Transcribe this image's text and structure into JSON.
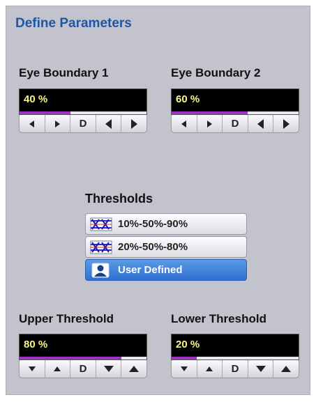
{
  "title": "Define Parameters",
  "eye_boundary_1": {
    "label": "Eye Boundary 1",
    "value": "40 %",
    "level_percent": 40
  },
  "eye_boundary_2": {
    "label": "Eye Boundary 2",
    "value": "60 %",
    "level_percent": 60
  },
  "thresholds": {
    "label": "Thresholds",
    "options": [
      {
        "label": "10%-50%-90%",
        "icon": "threshold-levels-icon",
        "selected": false
      },
      {
        "label": "20%-50%-80%",
        "icon": "threshold-levels-icon",
        "selected": false
      },
      {
        "label": "User Defined",
        "icon": "user-icon",
        "selected": true
      }
    ]
  },
  "upper_threshold": {
    "label": "Upper Threshold",
    "value": "80 %",
    "level_percent": 80
  },
  "lower_threshold": {
    "label": "Lower Threshold",
    "value": "20 %",
    "level_percent": 20
  },
  "stepper_default_label": "D",
  "colors": {
    "title": "#1f56a6",
    "panel_bg": "#c3c3cd",
    "value_text": "#f7f78a",
    "level_bar": "#a030c8",
    "selected_option": "#3b7fd8"
  }
}
